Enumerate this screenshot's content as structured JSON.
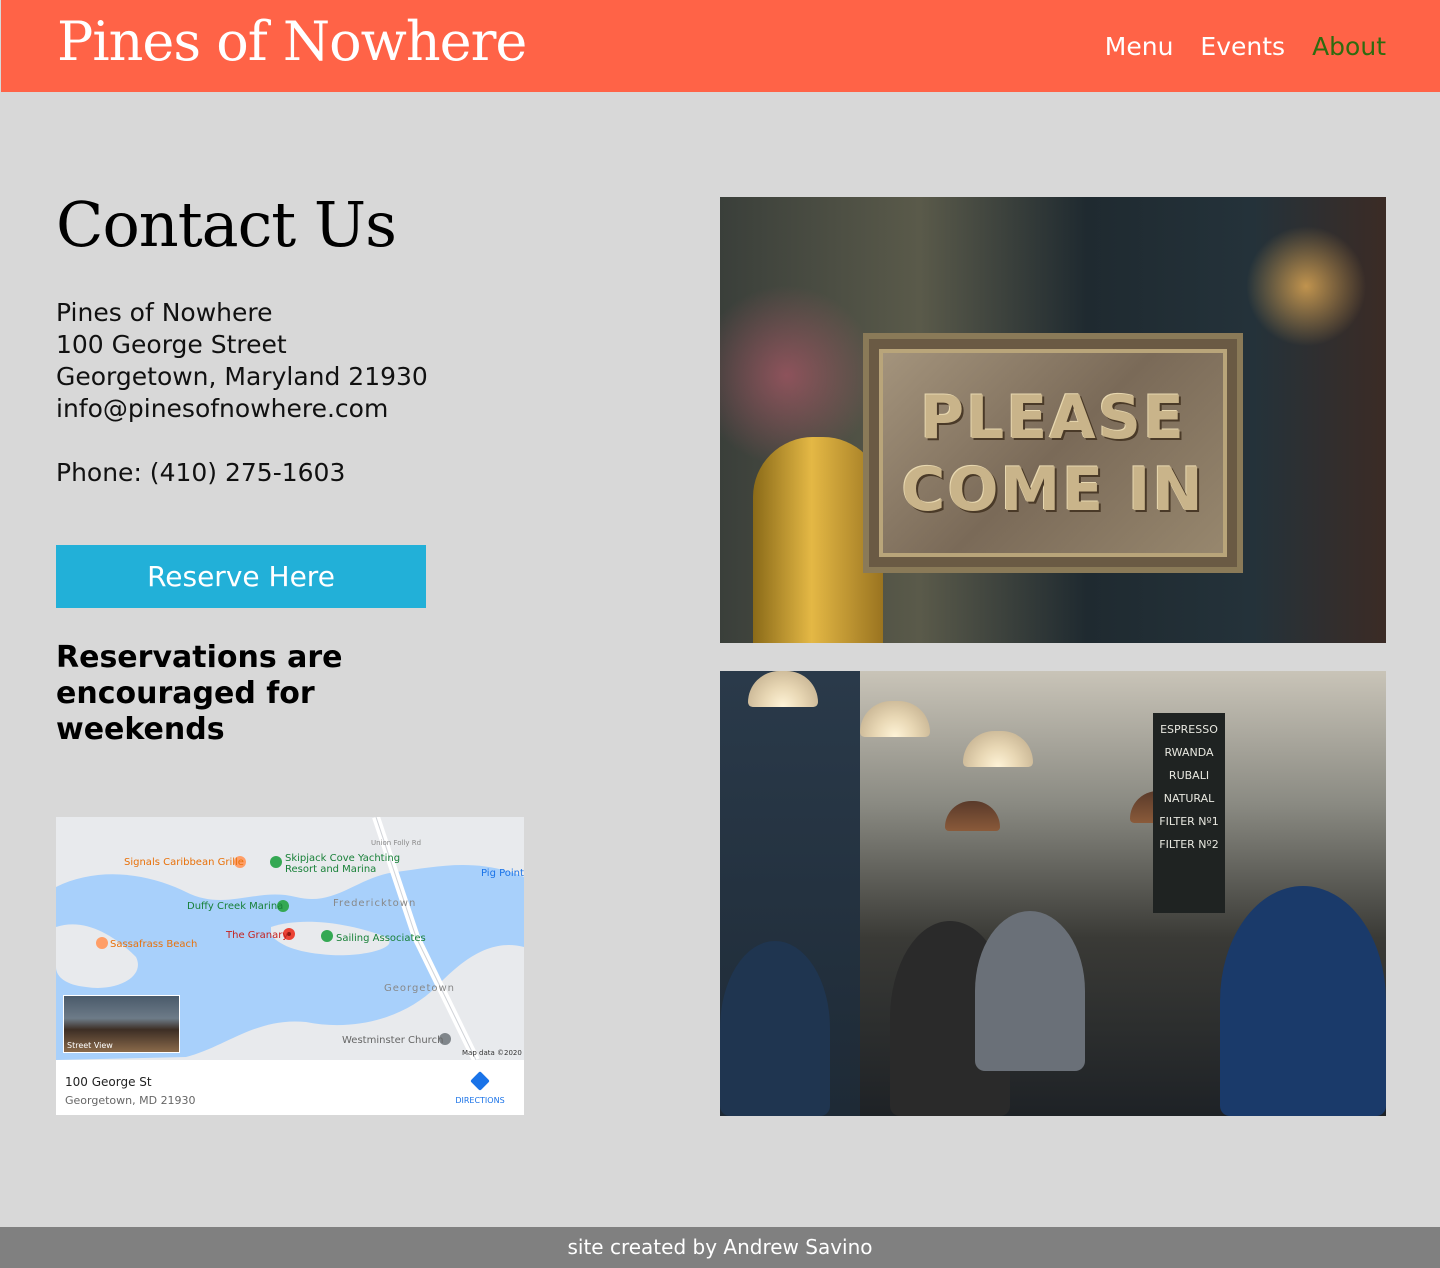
{
  "header": {
    "brand": "Pines of Nowhere",
    "nav": [
      {
        "label": "Menu",
        "active": false
      },
      {
        "label": "Events",
        "active": false
      },
      {
        "label": "About",
        "active": true
      }
    ],
    "background": "#ff6347",
    "active_color": "#2e6b0f"
  },
  "contact": {
    "title": "Contact Us",
    "address_lines": [
      "Pines of Nowhere",
      "100 George Street",
      "Georgetown, Maryland 21930",
      "info@pinesofnowhere.com"
    ],
    "phone": "Phone: (410) 275-1603",
    "reserve_button": "Reserve Here",
    "reserve_color": "#22b0d8",
    "note": "Reservations are encouraged for weekends"
  },
  "map": {
    "labels": {
      "signals": "Signals Caribbean Grille",
      "skipjack1": "Skipjack Cove Yachting",
      "skipjack2": "Resort and Marina",
      "pigpoint": "Pig Point",
      "duffy": "Duffy Creek Marina",
      "fredericktown": "Fredericktown",
      "sassafras": "Sassafrass Beach",
      "granary": "The Granary",
      "sailing": "Sailing Associates",
      "georgetown": "Georgetown",
      "westminster": "Westminster Church",
      "union": "Union Folly Rd",
      "mapdata": "Map data ©2020",
      "streetview": "Street View"
    },
    "card_title": "100 George St",
    "card_subtitle": "Georgetown, MD 21930",
    "directions": "DIRECTIONS"
  },
  "photos": {
    "sign_line1": "PLEASE",
    "sign_line2": "COME IN",
    "board_lines": [
      "ESPRESSO",
      "RWANDA",
      "RUBALI",
      "NATURAL",
      "FILTER Nº1",
      "FILTER Nº2"
    ]
  },
  "footer": {
    "credit": "site created by Andrew Savino"
  }
}
